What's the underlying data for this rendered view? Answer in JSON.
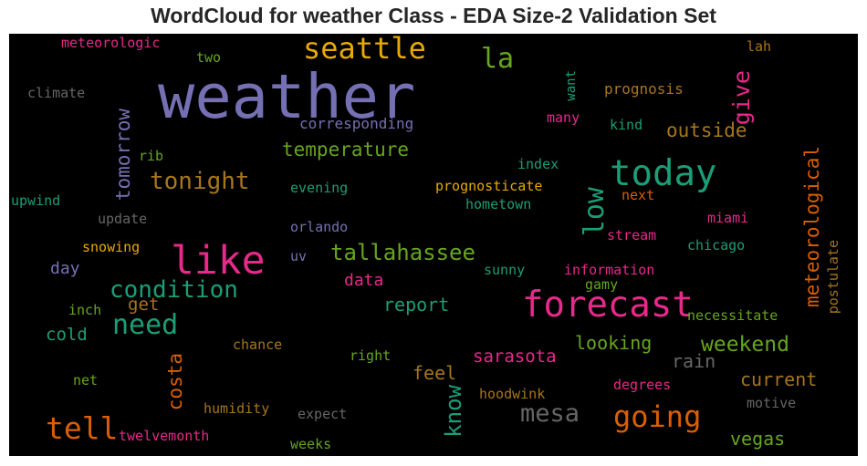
{
  "chart_data": {
    "type": "wordcloud",
    "title": "WordCloud for weather Class - EDA Size-2 Validation Set",
    "background": "#000000",
    "words": [
      {
        "text": "weather",
        "color": "#7570b3",
        "rank": 100,
        "vertical": false
      },
      {
        "text": "like",
        "color": "#e7298a",
        "rank": 62,
        "vertical": false
      },
      {
        "text": "forecast",
        "color": "#e7298a",
        "rank": 55,
        "vertical": false
      },
      {
        "text": "today",
        "color": "#1b9e77",
        "rank": 55,
        "vertical": false
      },
      {
        "text": "seattle",
        "color": "#e6ab02",
        "rank": 44,
        "vertical": false
      },
      {
        "text": "tell",
        "color": "#d95f02",
        "rank": 46,
        "vertical": false
      },
      {
        "text": "going",
        "color": "#d95f02",
        "rank": 44,
        "vertical": false
      },
      {
        "text": "need",
        "color": "#1b9e77",
        "rank": 40,
        "vertical": false
      },
      {
        "text": "la",
        "color": "#66a61e",
        "rank": 40,
        "vertical": false
      },
      {
        "text": "low",
        "color": "#1b9e77",
        "rank": 40,
        "vertical": true
      },
      {
        "text": "mesa",
        "color": "#666666",
        "rank": 36,
        "vertical": false
      },
      {
        "text": "tonight",
        "color": "#a6761d",
        "rank": 34,
        "vertical": false
      },
      {
        "text": "condition",
        "color": "#1b9e77",
        "rank": 34,
        "vertical": false
      },
      {
        "text": "tallahassee",
        "color": "#66a61e",
        "rank": 31,
        "vertical": false
      },
      {
        "text": "give",
        "color": "#e7298a",
        "rank": 33,
        "vertical": true
      },
      {
        "text": "weekend",
        "color": "#66a61e",
        "rank": 30,
        "vertical": false
      },
      {
        "text": "know",
        "color": "#1b9e77",
        "rank": 31,
        "vertical": true
      },
      {
        "text": "meteorological",
        "color": "#d95f02",
        "rank": 27,
        "vertical": true
      },
      {
        "text": "outside",
        "color": "#a6761d",
        "rank": 27,
        "vertical": false
      },
      {
        "text": "tomorrow",
        "color": "#7570b3",
        "rank": 26,
        "vertical": true
      },
      {
        "text": "temperature",
        "color": "#66a61e",
        "rank": 26,
        "vertical": false
      },
      {
        "text": "costa",
        "color": "#d95f02",
        "rank": 26,
        "vertical": true
      },
      {
        "text": "report",
        "color": "#1b9e77",
        "rank": 25,
        "vertical": false
      },
      {
        "text": "looking",
        "color": "#66a61e",
        "rank": 25,
        "vertical": false
      },
      {
        "text": "current",
        "color": "#a6761d",
        "rank": 25,
        "vertical": false
      },
      {
        "text": "feel",
        "color": "#a6761d",
        "rank": 25,
        "vertical": false
      },
      {
        "text": "rain",
        "color": "#666666",
        "rank": 25,
        "vertical": false
      },
      {
        "text": "vegas",
        "color": "#66a61e",
        "rank": 24,
        "vertical": false
      },
      {
        "text": "sarasota",
        "color": "#e7298a",
        "rank": 23,
        "vertical": false
      },
      {
        "text": "cold",
        "color": "#1b9e77",
        "rank": 23,
        "vertical": false
      },
      {
        "text": "get",
        "color": "#a6761d",
        "rank": 23,
        "vertical": false
      },
      {
        "text": "data",
        "color": "#e7298a",
        "rank": 22,
        "vertical": false
      },
      {
        "text": "day",
        "color": "#7570b3",
        "rank": 22,
        "vertical": false
      },
      {
        "text": "corresponding",
        "color": "#7570b3",
        "rank": 19,
        "vertical": false
      },
      {
        "text": "prognosis",
        "color": "#a6761d",
        "rank": 18,
        "vertical": false
      },
      {
        "text": "meteorologic",
        "color": "#e7298a",
        "rank": 17,
        "vertical": false
      },
      {
        "text": "climate",
        "color": "#666666",
        "rank": 17,
        "vertical": false
      },
      {
        "text": "kind",
        "color": "#1b9e77",
        "rank": 17,
        "vertical": false
      },
      {
        "text": "many",
        "color": "#e7298a",
        "rank": 17,
        "vertical": false
      },
      {
        "text": "two",
        "color": "#66a61e",
        "rank": 17,
        "vertical": false
      },
      {
        "text": "lah",
        "color": "#a6761d",
        "rank": 17,
        "vertical": false
      },
      {
        "text": "want",
        "color": "#1b9e77",
        "rank": 15,
        "vertical": true
      },
      {
        "text": "rib",
        "color": "#66a61e",
        "rank": 17,
        "vertical": false
      },
      {
        "text": "index",
        "color": "#1b9e77",
        "rank": 17,
        "vertical": false
      },
      {
        "text": "prognosticate",
        "color": "#e6ab02",
        "rank": 17,
        "vertical": false
      },
      {
        "text": "evening",
        "color": "#1b9e77",
        "rank": 17,
        "vertical": false
      },
      {
        "text": "next",
        "color": "#d95f02",
        "rank": 17,
        "vertical": false
      },
      {
        "text": "upwind",
        "color": "#1b9e77",
        "rank": 17,
        "vertical": false
      },
      {
        "text": "hometown",
        "color": "#1b9e77",
        "rank": 17,
        "vertical": false
      },
      {
        "text": "update",
        "color": "#666666",
        "rank": 17,
        "vertical": false
      },
      {
        "text": "orlando",
        "color": "#7570b3",
        "rank": 17,
        "vertical": false
      },
      {
        "text": "miami",
        "color": "#e7298a",
        "rank": 17,
        "vertical": false
      },
      {
        "text": "stream",
        "color": "#e7298a",
        "rank": 17,
        "vertical": false
      },
      {
        "text": "snowing",
        "color": "#e6ab02",
        "rank": 17,
        "vertical": false
      },
      {
        "text": "uv",
        "color": "#7570b3",
        "rank": 17,
        "vertical": false
      },
      {
        "text": "chicago",
        "color": "#1b9e77",
        "rank": 17,
        "vertical": false
      },
      {
        "text": "postulate",
        "color": "#a6761d",
        "rank": 16,
        "vertical": true
      },
      {
        "text": "sunny",
        "color": "#1b9e77",
        "rank": 17,
        "vertical": false
      },
      {
        "text": "information",
        "color": "#e7298a",
        "rank": 17,
        "vertical": false
      },
      {
        "text": "gamy",
        "color": "#66a61e",
        "rank": 16,
        "vertical": false
      },
      {
        "text": "inch",
        "color": "#66a61e",
        "rank": 17,
        "vertical": false
      },
      {
        "text": "necessitate",
        "color": "#66a61e",
        "rank": 17,
        "vertical": false
      },
      {
        "text": "chance",
        "color": "#a6761d",
        "rank": 17,
        "vertical": false
      },
      {
        "text": "right",
        "color": "#66a61e",
        "rank": 17,
        "vertical": false
      },
      {
        "text": "net",
        "color": "#66a61e",
        "rank": 17,
        "vertical": false
      },
      {
        "text": "degrees",
        "color": "#e7298a",
        "rank": 17,
        "vertical": false
      },
      {
        "text": "hoodwink",
        "color": "#a6761d",
        "rank": 17,
        "vertical": false
      },
      {
        "text": "humidity",
        "color": "#a6761d",
        "rank": 17,
        "vertical": false
      },
      {
        "text": "motive",
        "color": "#666666",
        "rank": 17,
        "vertical": false
      },
      {
        "text": "expect",
        "color": "#666666",
        "rank": 17,
        "vertical": false
      },
      {
        "text": "twelvemonth",
        "color": "#e7298a",
        "rank": 17,
        "vertical": false
      },
      {
        "text": "weeks",
        "color": "#66a61e",
        "rank": 16,
        "vertical": false
      }
    ]
  }
}
